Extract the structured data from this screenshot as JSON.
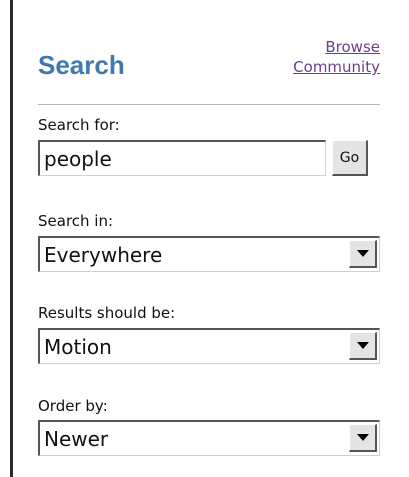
{
  "header": {
    "title": "Search",
    "browse_line1": "Browse",
    "browse_line2": "Community"
  },
  "search_for": {
    "label": "Search for:",
    "value": "people",
    "button_label": "Go"
  },
  "search_in": {
    "label": "Search in:",
    "selected": "Everywhere"
  },
  "results": {
    "label": "Results should be:",
    "selected": "Motion"
  },
  "order_by": {
    "label": "Order by:",
    "selected": "Newer"
  },
  "icons": {
    "dropdown": "chevron-down-icon"
  },
  "colors": {
    "title": "#3f79b0",
    "link": "#6b3f8c"
  }
}
